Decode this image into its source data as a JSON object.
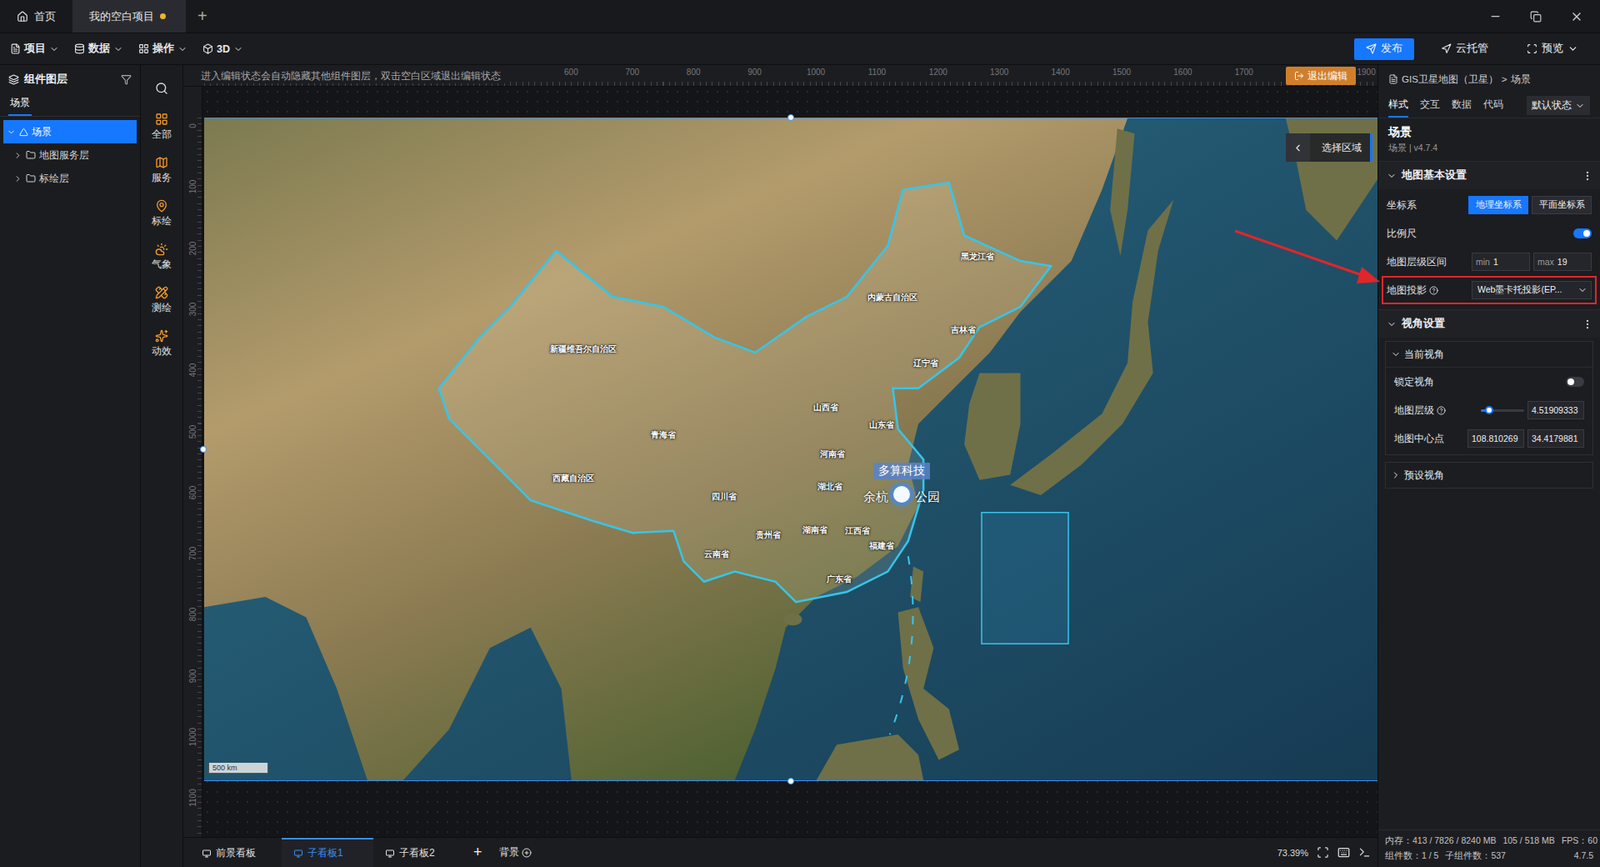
{
  "titlebar": {
    "tabs": [
      {
        "label": "首页",
        "kind": "home",
        "selected": false,
        "unsaved": false
      },
      {
        "label": "我的空白项目",
        "kind": "project",
        "selected": true,
        "unsaved": true
      }
    ],
    "new_tab": "+"
  },
  "toolbar": {
    "menus": [
      {
        "label": "项目"
      },
      {
        "label": "数据"
      },
      {
        "label": "操作"
      },
      {
        "label": "3D"
      }
    ],
    "actions": [
      {
        "label": "发布",
        "primary": true,
        "dropdown": false
      },
      {
        "label": "云托管",
        "primary": false,
        "dropdown": false
      },
      {
        "label": "预览",
        "primary": false,
        "dropdown": true
      }
    ]
  },
  "layers": {
    "title": "组件图层",
    "tab": "场景",
    "items": [
      {
        "label": "场景",
        "kind": "scene",
        "depth": 0,
        "expanded": true,
        "selected": true
      },
      {
        "label": "地图服务层",
        "kind": "folder",
        "depth": 1,
        "expanded": false,
        "selected": false
      },
      {
        "label": "标绘层",
        "kind": "folder",
        "depth": 1,
        "expanded": false,
        "selected": false
      }
    ]
  },
  "categories": [
    {
      "label": "全部"
    },
    {
      "label": "服务"
    },
    {
      "label": "标绘"
    },
    {
      "label": "气象"
    },
    {
      "label": "测绘"
    },
    {
      "label": "动效"
    }
  ],
  "canvas": {
    "hint": "进入编辑状态会自动隐藏其他组件图层，双击空白区域退出编辑状态",
    "exit": "退出编辑",
    "ruler_x": [
      "600",
      "700",
      "800",
      "900",
      "1000",
      "1100",
      "1200",
      "1300",
      "1400",
      "1500",
      "1600",
      "1700",
      "1900"
    ],
    "ruler_y": [
      "0",
      "100",
      "200",
      "300",
      "400",
      "500",
      "600",
      "700",
      "800",
      "900",
      "1000",
      "1100"
    ]
  },
  "map": {
    "regions": [
      {
        "label": "黑龙江省"
      },
      {
        "label": "内蒙古自治区"
      },
      {
        "label": "吉林省"
      },
      {
        "label": "新疆维吾尔自治区"
      },
      {
        "label": "辽宁省"
      },
      {
        "label": "山西省"
      },
      {
        "label": "山东省"
      },
      {
        "label": "青海省"
      },
      {
        "label": "河南省"
      },
      {
        "label": "西藏自治区"
      },
      {
        "label": "四川省"
      },
      {
        "label": "湖北省"
      },
      {
        "label": "贵州省"
      },
      {
        "label": "湖南省"
      },
      {
        "label": "江西省"
      },
      {
        "label": "云南省"
      },
      {
        "label": "福建省"
      },
      {
        "label": "广东省"
      }
    ],
    "select_region": "选择区域",
    "scale": "500 km",
    "poi": {
      "tag": "多算科技",
      "name_left": "余杭",
      "name_right": "公园"
    }
  },
  "boards": {
    "items": [
      {
        "label": "前景看板",
        "selected": false
      },
      {
        "label": "子看板1",
        "selected": true
      },
      {
        "label": "子看板2",
        "selected": false
      }
    ],
    "add": "+",
    "background": "背景",
    "zoom": "73.39%"
  },
  "inspector": {
    "breadcrumb": [
      "GIS卫星地图（卫星）",
      "场景"
    ],
    "separator": ">",
    "tabs": [
      {
        "label": "样式",
        "selected": true
      },
      {
        "label": "交互",
        "selected": false
      },
      {
        "label": "数据",
        "selected": false
      },
      {
        "label": "代码",
        "selected": false
      }
    ],
    "state_select": "默认状态",
    "title": "场景",
    "subtitle": "场景 | v4.7.4",
    "sections": [
      {
        "title": "地图基本设置",
        "expanded": true,
        "rows": [
          {
            "kind": "segmented",
            "label": "坐标系",
            "help": false,
            "highlighted": false,
            "options": [
              {
                "label": "地理坐标系",
                "selected": true
              },
              {
                "label": "平面坐标系",
                "selected": false
              }
            ]
          },
          {
            "kind": "toggle",
            "label": "比例尺",
            "help": false,
            "highlighted": false,
            "on": true
          },
          {
            "kind": "range",
            "label": "地图层级区间",
            "help": false,
            "highlighted": false,
            "min_label": "min",
            "min": "1",
            "max_label": "max",
            "max": "19"
          },
          {
            "kind": "select",
            "label": "地图投影",
            "help": true,
            "highlighted": true,
            "value": "Web墨卡托投影(EP..."
          }
        ],
        "groups": []
      },
      {
        "title": "视角设置",
        "expanded": true,
        "rows": [],
        "groups": [
          {
            "title": "当前视角",
            "expanded": true,
            "rows": [
              {
                "kind": "toggle",
                "label": "锁定视角",
                "help": false,
                "highlighted": false,
                "on": false
              },
              {
                "kind": "slider",
                "label": "地图层级",
                "help": true,
                "highlighted": false,
                "level": 0.2,
                "value": "4.51909333"
              },
              {
                "kind": "pair",
                "label": "地图中心点",
                "help": false,
                "highlighted": false,
                "values": [
                  "108.810269",
                  "34.4179881"
                ]
              }
            ]
          },
          {
            "title": "预设视角",
            "expanded": false,
            "rows": []
          }
        ]
      }
    ]
  },
  "status": {
    "memory": "内存：413 / 7826 / 8240 MB",
    "gpu": "105 / 518 MB",
    "fps": "FPS：60",
    "components": "组件数：1 / 5",
    "children": "子组件数：537",
    "version": "4.7.5"
  }
}
